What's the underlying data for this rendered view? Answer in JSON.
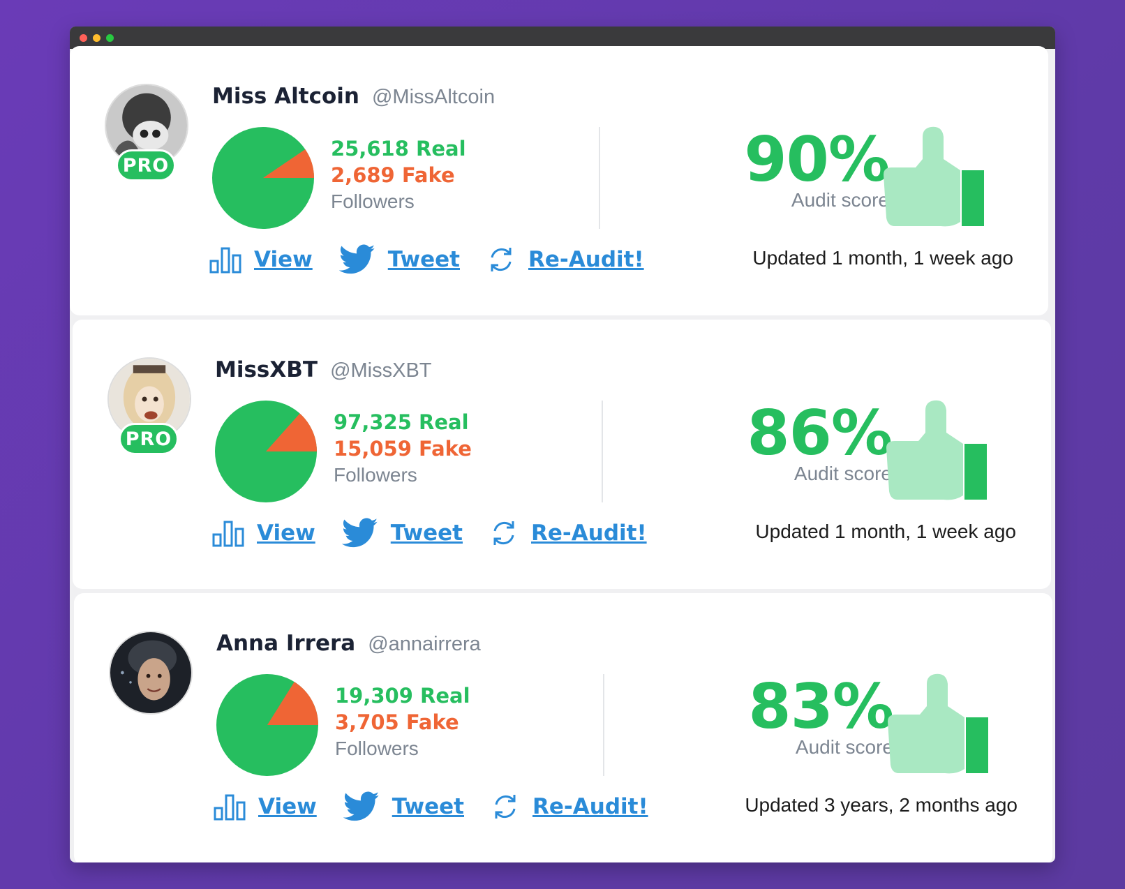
{
  "window": {
    "colors": {
      "accent_green": "#26be5f",
      "fake_orange": "#ef6535",
      "link_blue": "#2a8bd8",
      "thumb_light": "#a9e8c2"
    }
  },
  "accounts": [
    {
      "name": "Miss Altcoin",
      "handle": "@MissAltcoin",
      "pro_label": "PRO",
      "is_pro": true,
      "real_label": "25,618 Real",
      "fake_label": "2,689 Fake",
      "real_count": 25618,
      "fake_count": 2689,
      "followers_label": "Followers",
      "score": "90%",
      "score_label": "Audit score",
      "updated": "Updated 1 month, 1 week ago",
      "avatar_icon": "avatar-grayscale-photo",
      "view_label": "View",
      "tweet_label": "Tweet",
      "reaudit_label": "Re-Audit!"
    },
    {
      "name": "MissXBT",
      "handle": "@MissXBT",
      "pro_label": "PRO",
      "is_pro": true,
      "real_label": "97,325 Real",
      "fake_label": "15,059 Fake",
      "real_count": 97325,
      "fake_count": 15059,
      "followers_label": "Followers",
      "score": "86%",
      "score_label": "Audit score",
      "updated": "Updated 1 month, 1 week ago",
      "avatar_icon": "avatar-anime-photo",
      "view_label": "View",
      "tweet_label": "Tweet",
      "reaudit_label": "Re-Audit!"
    },
    {
      "name": "Anna Irrera",
      "handle": "@annairrera",
      "pro_label": "",
      "is_pro": false,
      "real_label": "19,309 Real",
      "fake_label": "3,705 Fake",
      "real_count": 19309,
      "fake_count": 3705,
      "followers_label": "Followers",
      "score": "83%",
      "score_label": "Audit score",
      "updated": "Updated 3 years, 2 months ago",
      "avatar_icon": "avatar-portrait-photo",
      "view_label": "View",
      "tweet_label": "Tweet",
      "reaudit_label": "Re-Audit!"
    }
  ]
}
